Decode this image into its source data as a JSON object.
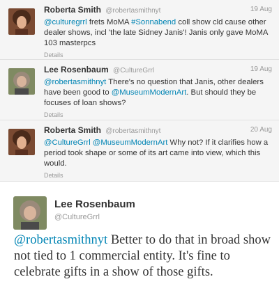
{
  "tweets": [
    {
      "name": "Roberta Smith",
      "handle": "@robertasmithnyt",
      "time": "19 Aug",
      "mention": "@culturegrrl",
      "text_a": " frets MoMA ",
      "hashtag": "#Sonnabend",
      "text_b": " coll show cld cause other dealer shows, incl 'the late Sidney Janis'! Janis only gave MoMA 103 masterpcs",
      "details": "Details"
    },
    {
      "name": "Lee Rosenbaum",
      "handle": "@CultureGrrl",
      "time": "19 Aug",
      "mention": "@robertasmithnyt",
      "text_a": " There's no question that Janis, other dealers have been good to ",
      "mention2": "@MuseumModernArt",
      "text_b": ". But should they be focuses of loan shows?",
      "details": "Details"
    },
    {
      "name": "Roberta Smith",
      "handle": "@robertasmithnyt",
      "time": "20 Aug",
      "mention": "@CultureGrrl",
      "mention2": "@MuseumModernArt",
      "text_b": " Why not? If it clarifies how a  period took shape or some of its art came into view, which this would.",
      "details": "Details"
    }
  ],
  "expanded": {
    "name": "Lee Rosenbaum",
    "handle": "@CultureGrrl",
    "mention": "@robertasmithnyt",
    "text": " Better to do that in broad show not tied to 1 commercial entity. It's fine to celebrate gifts in a show of those gifts."
  },
  "colors": {
    "link": "#0084b4",
    "meta": "#999999",
    "text": "#333333",
    "stream_bg": "#f5f5f5"
  }
}
